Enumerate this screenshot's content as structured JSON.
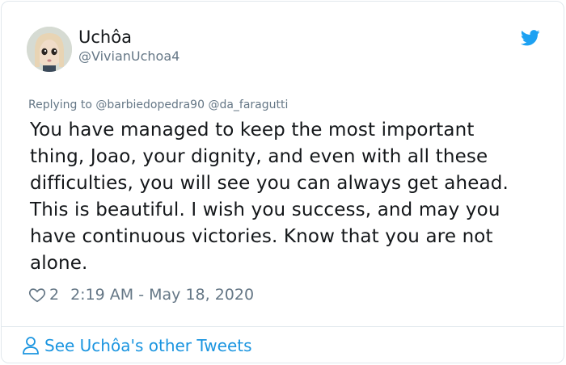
{
  "author": {
    "display_name": "Uchôa",
    "handle": "@VivianUchoa4"
  },
  "reply": {
    "prefix": "Replying to",
    "mention_1": "@barbiedopedra90",
    "mention_2": "@da_faragutti"
  },
  "tweet": {
    "lines": [
      "You have managed to keep the most important",
      "thing, Joao, your dignity, and even with all these",
      "difficulties, you will see you can always get ahead.",
      "This is beautiful. I wish you success, and may you",
      "have continuous victories. Know that you are not",
      "alone."
    ]
  },
  "meta": {
    "likes": "2",
    "timestamp": "2:19 AM - May 18, 2020"
  },
  "footer": {
    "see_more": "See Uchôa's other Tweets"
  },
  "icons": {
    "brand": "twitter-bird-icon",
    "like": "heart-icon",
    "profile": "person-icon"
  },
  "colors": {
    "accent": "#1da1f2",
    "link": "#1b95e0",
    "muted": "#657786",
    "text": "#14171a",
    "border": "#e1e8ed"
  }
}
